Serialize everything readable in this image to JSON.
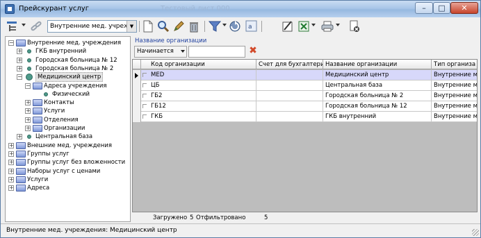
{
  "window": {
    "title": "Прейскурант услуг",
    "ghost_title": "Тестовый лист 000",
    "controls": {
      "minimize": "–",
      "maximize": "□",
      "close": "✕"
    }
  },
  "toolbar": {
    "combo_value": "Внутренние мед. учрежден",
    "icons": [
      "structure-icon",
      "link-icon",
      "new-document-icon",
      "search-icon",
      "edit-icon",
      "delete-icon",
      "filter-icon",
      "refresh-icon",
      "text-icon",
      "edit-frame-icon",
      "excel-export-icon",
      "print-icon",
      "exit-icon"
    ]
  },
  "tree": {
    "nodes": [
      {
        "label": "Внутренние мед. учреждения",
        "kind": "folder",
        "expander": "−"
      },
      {
        "label": "ГКБ внутренний",
        "kind": "dot",
        "expander": "+"
      },
      {
        "label": "Городская больница № 12",
        "kind": "dot",
        "expander": "+"
      },
      {
        "label": "Городская больница № 2",
        "kind": "dot",
        "expander": "+"
      },
      {
        "label": "Медицинский центр",
        "kind": "dot-big",
        "expander": "−"
      },
      {
        "label": "Адреса учреждения",
        "kind": "folder",
        "expander": "−"
      },
      {
        "label": "Физический",
        "kind": "dot",
        "expander": ""
      },
      {
        "label": "Контакты",
        "kind": "folder",
        "expander": "+"
      },
      {
        "label": "Услуги",
        "kind": "folder",
        "expander": "+"
      },
      {
        "label": "Отделения",
        "kind": "folder",
        "expander": "+"
      },
      {
        "label": "Организации",
        "kind": "folder",
        "expander": "+"
      },
      {
        "label": "Центральная база",
        "kind": "dot",
        "expander": "+"
      },
      {
        "label": "Внешние мед. учреждения",
        "kind": "folder",
        "expander": "+"
      },
      {
        "label": "Группы услуг",
        "kind": "folder",
        "expander": "+"
      },
      {
        "label": "Группы услуг без вложенности",
        "kind": "folder",
        "expander": "+"
      },
      {
        "label": "Наборы услуг с ценами",
        "kind": "folder",
        "expander": "+"
      },
      {
        "label": "Услуги",
        "kind": "folder",
        "expander": "+"
      },
      {
        "label": "Адреса",
        "kind": "folder",
        "expander": "+"
      }
    ]
  },
  "filter": {
    "label": "Название организации",
    "mode": "Начинается",
    "value": "",
    "clear_symbol": "✖"
  },
  "grid": {
    "columns": [
      "Код организации",
      "Счет для бухгалтерии",
      "Название организации",
      "Тип организа"
    ],
    "rows": [
      {
        "code": "MED",
        "account": "",
        "name": "Медицинский центр",
        "type": "Внутренние м"
      },
      {
        "code": "ЦБ",
        "account": "",
        "name": "Центральная база",
        "type": "Внутренние м"
      },
      {
        "code": "ГБ2",
        "account": "",
        "name": "Городская больница № 2",
        "type": "Внутренние м"
      },
      {
        "code": "ГБ12",
        "account": "",
        "name": "Городская больница № 12",
        "type": "Внутренние м"
      },
      {
        "code": "ГКБ",
        "account": "",
        "name": "ГКБ внутренний",
        "type": "Внутренние м"
      }
    ],
    "selected_row": 0
  },
  "grid_status": {
    "loaded_label": "Загружено",
    "loaded_count": "5",
    "filtered_label": "Отфильтровано",
    "filtered_count": "5"
  },
  "statusbar": {
    "text": "Внутренние мед. учреждения: Медицинский центр"
  },
  "colors": {
    "selection": "#d7d8fa",
    "folder": "#7f98d8",
    "dot": "#4e9a8a",
    "filter_label": "#1f3f9e",
    "clear_icon": "#d24a2a"
  }
}
